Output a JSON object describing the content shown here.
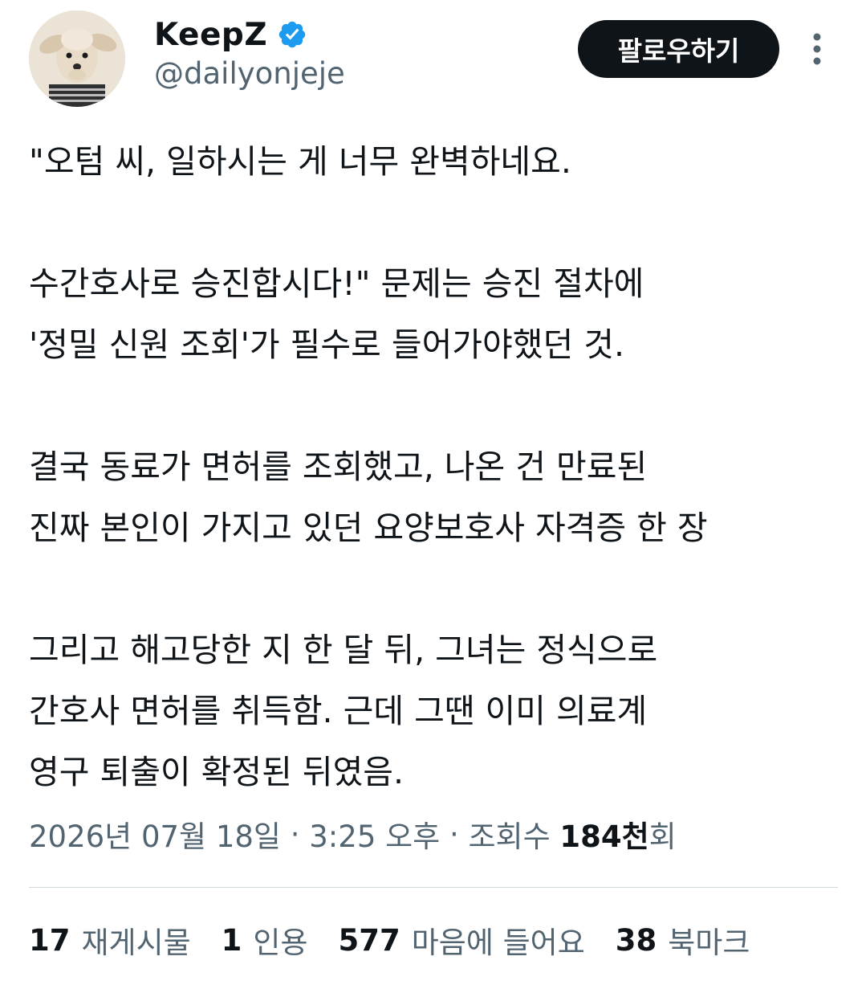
{
  "user": {
    "display_name": "KeepZ",
    "handle": "@dailyonjeje",
    "verified_color": "#1d9bf0"
  },
  "follow_button": {
    "label": "팔로우하기"
  },
  "icons": {
    "more": "more-vertical-icon",
    "verified": "verified-badge-icon"
  },
  "tweet": {
    "paragraphs": [
      [
        "\"오텀 씨, 일하시는 게 너무 완벽하네요."
      ],
      [
        "수간호사로 승진합시다!\" 문제는 승진 절차에",
        "'정밀 신원 조회'가 필수로 들어가야했던 것."
      ],
      [
        "결국 동료가 면허를 조회했고, 나온 건 만료된",
        "진짜 본인이 가지고 있던 요양보호사 자격증 한 장"
      ],
      [
        "그리고 해고당한 지 한 달 뒤, 그녀는 정식으로",
        "간호사 면허를 취득함. 근데 그땐 이미 의료계",
        "영구 퇴출이 확정된 뒤였음."
      ]
    ]
  },
  "meta": {
    "date": "2026년 07월 18일",
    "separator": " · ",
    "time": "3:25 오후",
    "views_label": "조회수 ",
    "views_count": "184천",
    "views_suffix": "회"
  },
  "stats": [
    {
      "count": "17",
      "label": "재게시물"
    },
    {
      "count": "1",
      "label": "인용"
    },
    {
      "count": "577",
      "label": "마음에 들어요"
    },
    {
      "count": "38",
      "label": "북마크"
    }
  ]
}
